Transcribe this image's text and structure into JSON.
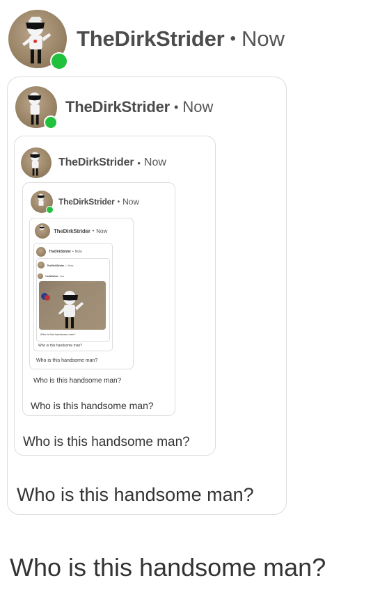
{
  "post": {
    "username": "TheDirkStrider",
    "separator": "•",
    "timestamp": "Now",
    "caption": "Who is this handsome man?"
  },
  "quoted_levels": [
    {
      "username": "TheDirkStrider",
      "separator": "•",
      "timestamp": "Now",
      "caption": "Who is this handsome man?"
    },
    {
      "username": "TheDirkStrider",
      "separator": "•",
      "timestamp": "Now",
      "caption": "Who is this handsome man?"
    },
    {
      "username": "TheDirkStrider",
      "separator": "•",
      "timestamp": "Now",
      "caption": "Who is this handsome man?"
    },
    {
      "username": "TheDirkStrider",
      "separator": "•",
      "timestamp": "Now",
      "caption": "Who is this handsome man?"
    },
    {
      "username": "TheDirkStrider",
      "separator": "•",
      "timestamp": "Now",
      "caption": "Who is this handsome man?"
    },
    {
      "username": "TheDirkStrider",
      "separator": "•",
      "timestamp": "Now",
      "caption": "Who is this handsome man?"
    },
    {
      "username": "TheDirkStrider",
      "separator": "•",
      "timestamp": "Now",
      "caption": "Who is this handsome man?"
    }
  ],
  "colors": {
    "online": "#22c13d",
    "card_border": "#dcdcdc",
    "text": "#3a3a3a"
  }
}
